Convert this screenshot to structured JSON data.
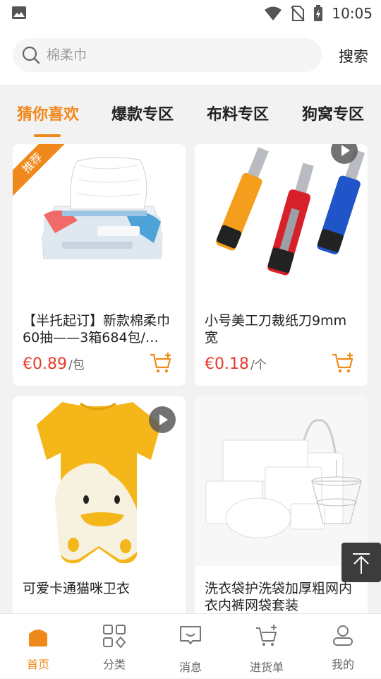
{
  "status_bar": {
    "time": "10:05"
  },
  "search": {
    "placeholder": "棉柔巾",
    "button_label": "搜索"
  },
  "tabs": [
    {
      "label": "猜你喜欢",
      "active": true
    },
    {
      "label": "爆款专区",
      "active": false
    },
    {
      "label": "布料专区",
      "active": false
    },
    {
      "label": "狗窝专区",
      "active": false
    }
  ],
  "products": [
    {
      "badge": "推荐",
      "title": "【半托起订】新款棉柔巾60抽——3箱684包/…",
      "price": "€0.89",
      "unit": "/包",
      "image_icon": "tissue-pack-image"
    },
    {
      "title": "小号美工刀裁纸刀9mm宽",
      "price": "€0.18",
      "unit": "/个",
      "image_icon": "utility-knives-image"
    },
    {
      "title": "可爱卡通猫咪卫衣",
      "image_icon": "duck-sweater-image"
    },
    {
      "title": "洗衣袋护洗袋加厚粗网内衣内裤网袋套装",
      "image_icon": "laundry-bags-image"
    }
  ],
  "bottom_nav": [
    {
      "label": "首页",
      "icon": "home-icon",
      "active": true
    },
    {
      "label": "分类",
      "icon": "category-icon",
      "active": false
    },
    {
      "label": "消息",
      "icon": "message-icon",
      "active": false
    },
    {
      "label": "进货单",
      "icon": "cart-icon",
      "active": false
    },
    {
      "label": "我的",
      "icon": "profile-icon",
      "active": false
    }
  ],
  "colors": {
    "accent": "#f0891b",
    "price": "#e53a2b",
    "background": "#f2f2f2"
  }
}
